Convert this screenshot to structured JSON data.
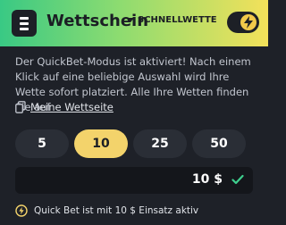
{
  "header": {
    "title": "Wettschein",
    "quick_bet_label": "SCHNELLWETTE",
    "quick_bet_enabled": true
  },
  "message": {
    "text": "Der QuickBet-Modus ist aktiviert! Nach einem Klick auf eine beliebige Auswahl wird Ihre Wette sofort platziert. Alle Ihre Wetten finden Sie auf",
    "link_label": "Meine Wettseite"
  },
  "stakes": {
    "options": [
      "5",
      "10",
      "25",
      "50"
    ],
    "selected": "10"
  },
  "amount": {
    "value": "10 $"
  },
  "status": {
    "text": "Quick Bet ist mit 10 $ Einsatz aktiv"
  },
  "colors": {
    "accent_yellow": "#f3d36b",
    "confirm_green": "#3ecf8e",
    "background": "#1e2128"
  }
}
